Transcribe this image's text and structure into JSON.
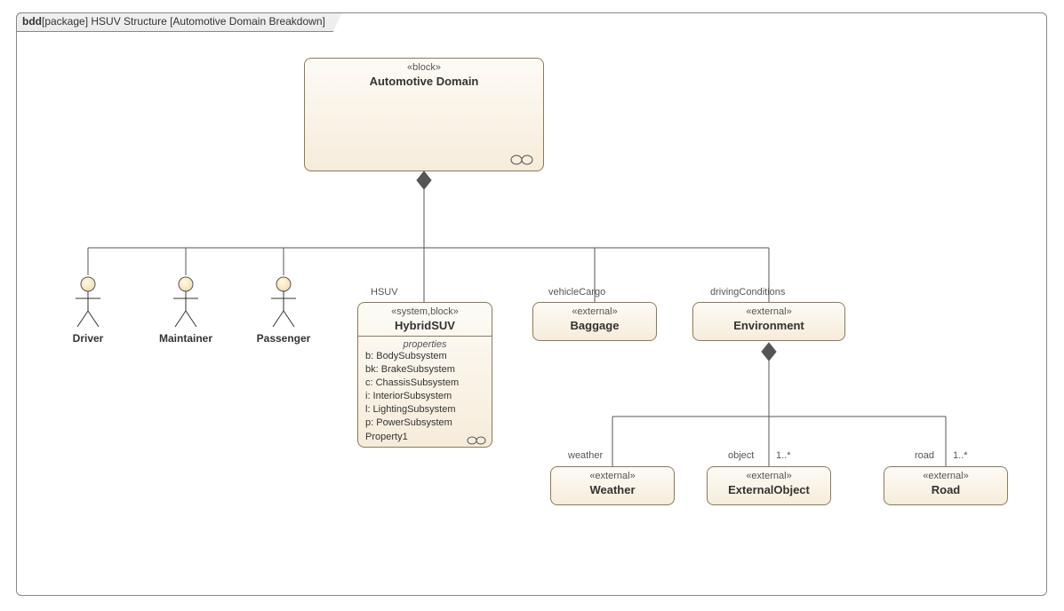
{
  "frame": {
    "prefix": "bdd",
    "bracket": "[package]",
    "title": " HSUV Structure ",
    "subtitle": "[Automotive Domain Breakdown]"
  },
  "blocks": {
    "domain": {
      "stereo": "«block»",
      "title": "Automotive Domain"
    },
    "hsuv": {
      "stereo": "«system,block»",
      "title": "HybridSUV",
      "propsHeader": "properties",
      "props": [
        "b: BodySubsystem",
        "bk: BrakeSubsystem",
        "c: ChassisSubsystem",
        "i: InteriorSubsystem",
        "l: LightingSubsystem",
        "p: PowerSubsystem",
        "Property1"
      ]
    },
    "baggage": {
      "stereo": "«external»",
      "title": "Baggage"
    },
    "environment": {
      "stereo": "«external»",
      "title": "Environment"
    },
    "weather": {
      "stereo": "«external»",
      "title": "Weather"
    },
    "extobj": {
      "stereo": "«external»",
      "title": "ExternalObject"
    },
    "road": {
      "stereo": "«external»",
      "title": "Road"
    }
  },
  "actors": {
    "driver": "Driver",
    "maintainer": "Maintainer",
    "passenger": "Passenger"
  },
  "roles": {
    "hsuv": "HSUV",
    "baggage": "vehicleCargo",
    "environment": "drivingConditions",
    "weather": "weather",
    "extobj": "object",
    "extobjMult": "1..*",
    "road": "road",
    "roadMult": "1..*"
  },
  "chart_data": {
    "type": "table",
    "diagram": "SysML Block Definition Diagram (bdd)",
    "package": "HSUV Structure",
    "view": "Automotive Domain Breakdown",
    "root": "Automotive Domain",
    "composition_from_AutomotiveDomain": [
      {
        "part": "Driver",
        "kind": "actor"
      },
      {
        "part": "Maintainer",
        "kind": "actor"
      },
      {
        "part": "Passenger",
        "kind": "actor"
      },
      {
        "part": "HybridSUV",
        "kind": "block",
        "role": "HSUV",
        "stereotypes": [
          "system",
          "block"
        ]
      },
      {
        "part": "Baggage",
        "kind": "block",
        "role": "vehicleCargo",
        "stereotypes": [
          "external"
        ]
      },
      {
        "part": "Environment",
        "kind": "block",
        "role": "drivingConditions",
        "stereotypes": [
          "external"
        ]
      }
    ],
    "composition_from_Environment": [
      {
        "part": "Weather",
        "role": "weather",
        "multiplicity": ""
      },
      {
        "part": "ExternalObject",
        "role": "object",
        "multiplicity": "1..*"
      },
      {
        "part": "Road",
        "role": "road",
        "multiplicity": "1..*"
      }
    ],
    "HybridSUV_properties": [
      "b: BodySubsystem",
      "bk: BrakeSubsystem",
      "c: ChassisSubsystem",
      "i: InteriorSubsystem",
      "l: LightingSubsystem",
      "p: PowerSubsystem",
      "Property1"
    ]
  }
}
